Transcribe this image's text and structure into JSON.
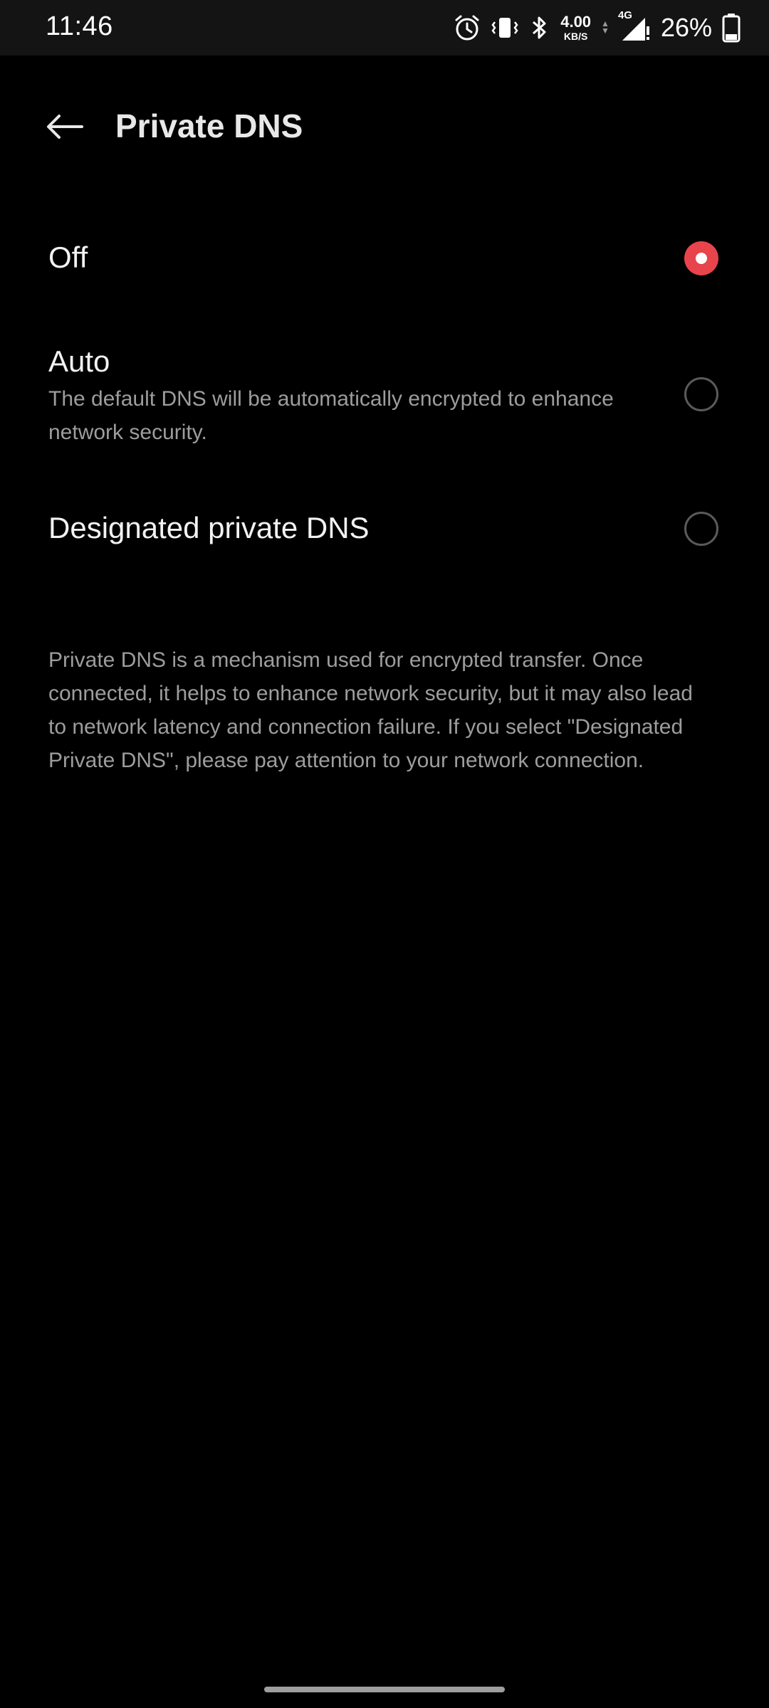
{
  "status_bar": {
    "time": "11:46",
    "net_speed_value": "4.00",
    "net_speed_unit": "KB/S",
    "network_type": "4G",
    "battery_percent": "26%",
    "icons": [
      "alarm-icon",
      "vibrate-icon",
      "bluetooth-icon",
      "signal-icon",
      "battery-icon"
    ]
  },
  "header": {
    "title": "Private DNS",
    "back_icon": "arrow-left-icon"
  },
  "options": [
    {
      "title": "Off",
      "description": "",
      "selected": true
    },
    {
      "title": "Auto",
      "description": "The default DNS will be automatically encrypted to enhance network security.",
      "selected": false
    },
    {
      "title": "Designated private DNS",
      "description": "",
      "selected": false
    }
  ],
  "info": {
    "text": "Private DNS is a mechanism used for encrypted transfer. Once connected, it helps to enhance network security, but it may also lead to network latency and connection failure. If you select \"Designated Private DNS\", please pay attention to your network connection."
  },
  "colors": {
    "accent": "#e8444b",
    "background": "#000000",
    "status_bar": "#141414",
    "secondary_text": "#9d9d9d"
  }
}
